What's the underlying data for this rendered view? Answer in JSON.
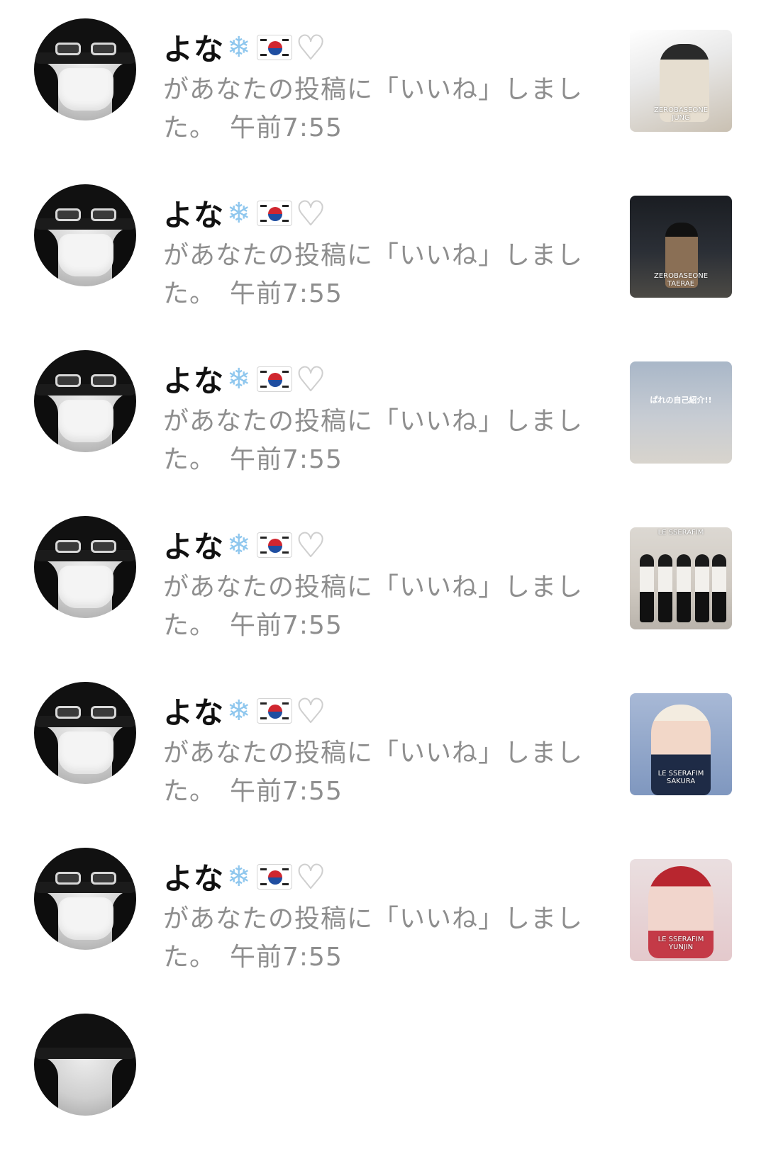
{
  "notifications": [
    {
      "username": "よな",
      "message": "があなたの投稿に「いいね」しました。",
      "time": "午前7:55",
      "thumbnail": {
        "caption": "ZEROBASEONE\nJUNG"
      }
    },
    {
      "username": "よな",
      "message": "があなたの投稿に「いいね」しました。",
      "time": "午前7:55",
      "thumbnail": {
        "caption": "ZEROBASEONE\nTAERAE"
      }
    },
    {
      "username": "よな",
      "message": "があなたの投稿に「いいね」しました。",
      "time": "午前7:55",
      "thumbnail": {
        "caption": "ぱれの自己紹介!!"
      }
    },
    {
      "username": "よな",
      "message": "があなたの投稿に「いいね」しました。",
      "time": "午前7:55",
      "thumbnail": {
        "caption": "LE SSERAFIM"
      }
    },
    {
      "username": "よな",
      "message": "があなたの投稿に「いいね」しました。",
      "time": "午前7:55",
      "thumbnail": {
        "caption": "LE SSERAFIM\nSAKURA"
      }
    },
    {
      "username": "よな",
      "message": "があなたの投稿に「いいね」しました。",
      "time": "午前7:55",
      "thumbnail": {
        "caption": "LE SSERAFIM\nYUNJIN"
      }
    }
  ],
  "icons": {
    "snowflake": "snowflake-icon",
    "flag": "south-korea-flag-icon",
    "heart": "white-heart-icon"
  },
  "colors": {
    "username": "#111111",
    "message": "#8e8e8e",
    "background": "#ffffff"
  }
}
